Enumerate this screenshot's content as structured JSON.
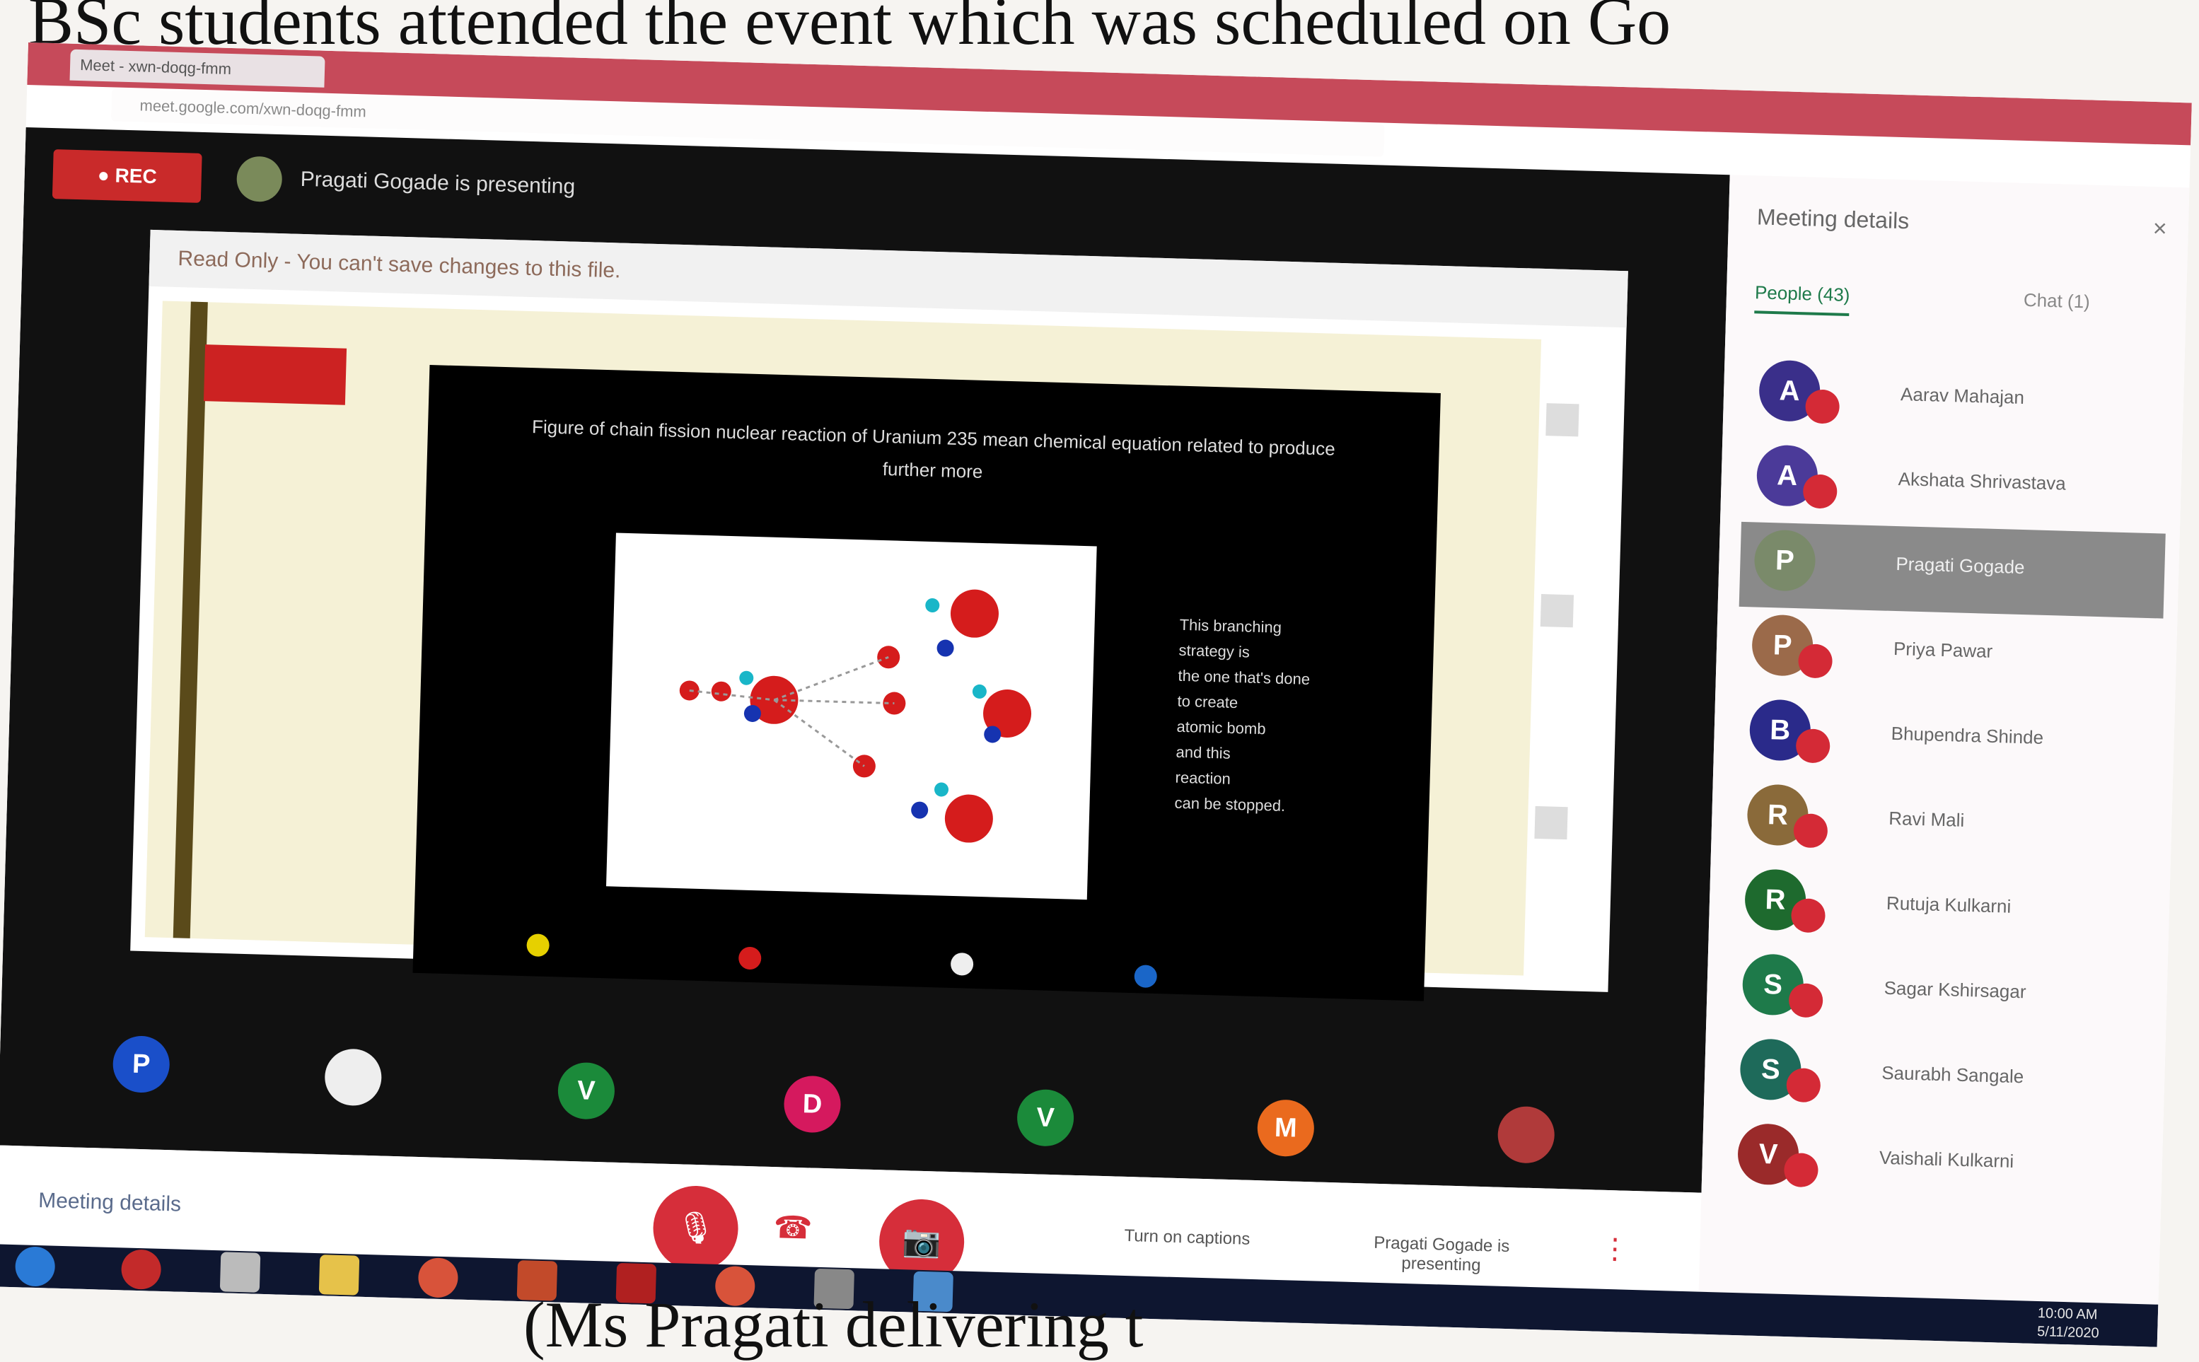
{
  "page": {
    "top_caption": "BSc students attended the event which was scheduled on Go",
    "bottom_caption": "(Ms Pragati delivering t"
  },
  "browser": {
    "tab_title": "Meet - xwn-doqg-fmm",
    "address": "meet.google.com/xwn-doqg-fmm"
  },
  "meeting": {
    "rec_label": "● REC",
    "presenting_text": "Pragati Gogade is presenting",
    "read_only_text": "Read Only - You can't save changes to this file.",
    "slide": {
      "title": "Figure of chain fission nuclear reaction of Uranium 235 mean chemical equation related to produce further more",
      "side_text": [
        "This branching",
        "strategy is",
        "the one that's done",
        "to create",
        "atomic bomb",
        "and this",
        "reaction",
        "can be stopped."
      ]
    },
    "tiles": [
      "P",
      "",
      "V",
      "D",
      "V",
      "M",
      ""
    ],
    "controls": {
      "meeting_details": "Meeting details",
      "mic_icon": "mic-off-icon",
      "hangup_icon": "phone-hangup-icon",
      "cam_icon": "camera-off-icon",
      "captions": "Turn on captions",
      "presenting": "Pragati Gogade is presenting",
      "more": "⋮"
    }
  },
  "panel": {
    "title": "Meeting details",
    "close": "×",
    "tab_people": "People (43)",
    "tab_chat": "Chat (1)",
    "participants": [
      {
        "initial": "A",
        "name": "Aarav Mahajan",
        "color": "#3a2f8a"
      },
      {
        "initial": "A",
        "name": "Akshata Shrivastava",
        "color": "#4b3a99"
      },
      {
        "initial": "P",
        "name": "Pragati Gogade",
        "color": "#7a8a6a"
      },
      {
        "initial": "P",
        "name": "Priya Pawar",
        "color": "#9b6a4a"
      },
      {
        "initial": "B",
        "name": "Bhupendra Shinde",
        "color": "#2a2a8a"
      },
      {
        "initial": "R",
        "name": "Ravi Mali",
        "color": "#8a6a3a"
      },
      {
        "initial": "R",
        "name": "Rutuja Kulkarni",
        "color": "#1e6a2e"
      },
      {
        "initial": "S",
        "name": "Sagar Kshirsagar",
        "color": "#1e7a4a"
      },
      {
        "initial": "S",
        "name": "Saurabh Sangale",
        "color": "#1e6a5a"
      },
      {
        "initial": "V",
        "name": "Vaishali Kulkarni",
        "color": "#9a2a2a"
      }
    ]
  },
  "taskbar": {
    "clock_time": "10:00 AM",
    "clock_date": "5/11/2020"
  }
}
